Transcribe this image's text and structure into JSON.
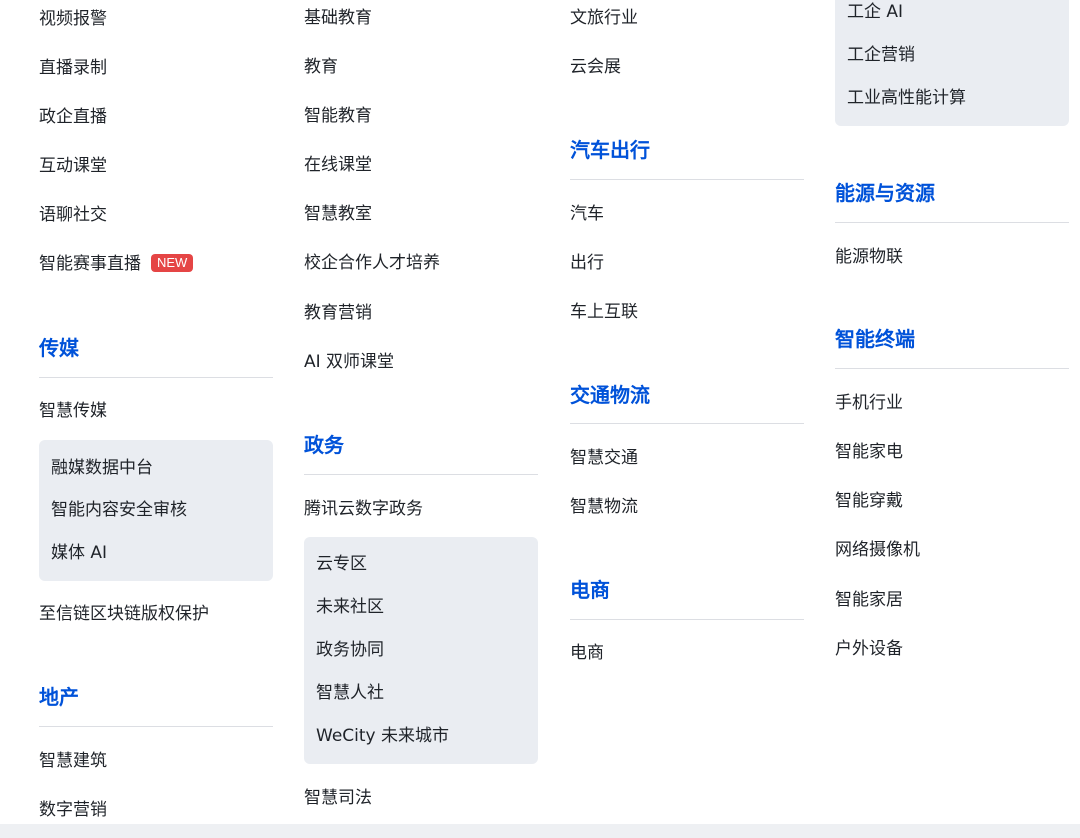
{
  "col1": {
    "items_top": [
      "视频报警",
      "直播录制",
      "政企直播",
      "互动课堂",
      "语聊社交",
      "智能赛事直播"
    ],
    "new_badge": "NEW",
    "media_heading": "传媒",
    "media_item": "智慧传媒",
    "media_sub": [
      "融媒数据中台",
      "智能内容安全审核",
      "媒体 AI"
    ],
    "media_after": "至信链区块链版权保护",
    "realestate_heading": "地产",
    "realestate_items": [
      "智慧建筑",
      "数字营销"
    ]
  },
  "col2": {
    "items_top": [
      "基础教育",
      "教育",
      "智能教育",
      "在线课堂",
      "智慧教室",
      "校企合作人才培养",
      "教育营销",
      "AI 双师课堂"
    ],
    "gov_heading": "政务",
    "gov_item": "腾讯云数字政务",
    "gov_sub": [
      "云专区",
      "未来社区",
      "政务协同",
      "智慧人社",
      "WeCity 未来城市"
    ],
    "gov_after": "智慧司法"
  },
  "col3": {
    "items_top": [
      "文旅行业",
      "云会展"
    ],
    "auto_heading": "汽车出行",
    "auto_items": [
      "汽车",
      "出行",
      "车上互联"
    ],
    "traffic_heading": "交通物流",
    "traffic_items": [
      "智慧交通",
      "智慧物流"
    ],
    "ecom_heading": "电商",
    "ecom_items": [
      "电商"
    ]
  },
  "col4": {
    "sub_top": [
      "工企 AI",
      "工企营销",
      "工业高性能计算"
    ],
    "energy_heading": "能源与资源",
    "energy_items": [
      "能源物联"
    ],
    "terminal_heading": "智能终端",
    "terminal_items": [
      "手机行业",
      "智能家电",
      "智能穿戴",
      "网络摄像机",
      "智能家居",
      "户外设备"
    ]
  }
}
